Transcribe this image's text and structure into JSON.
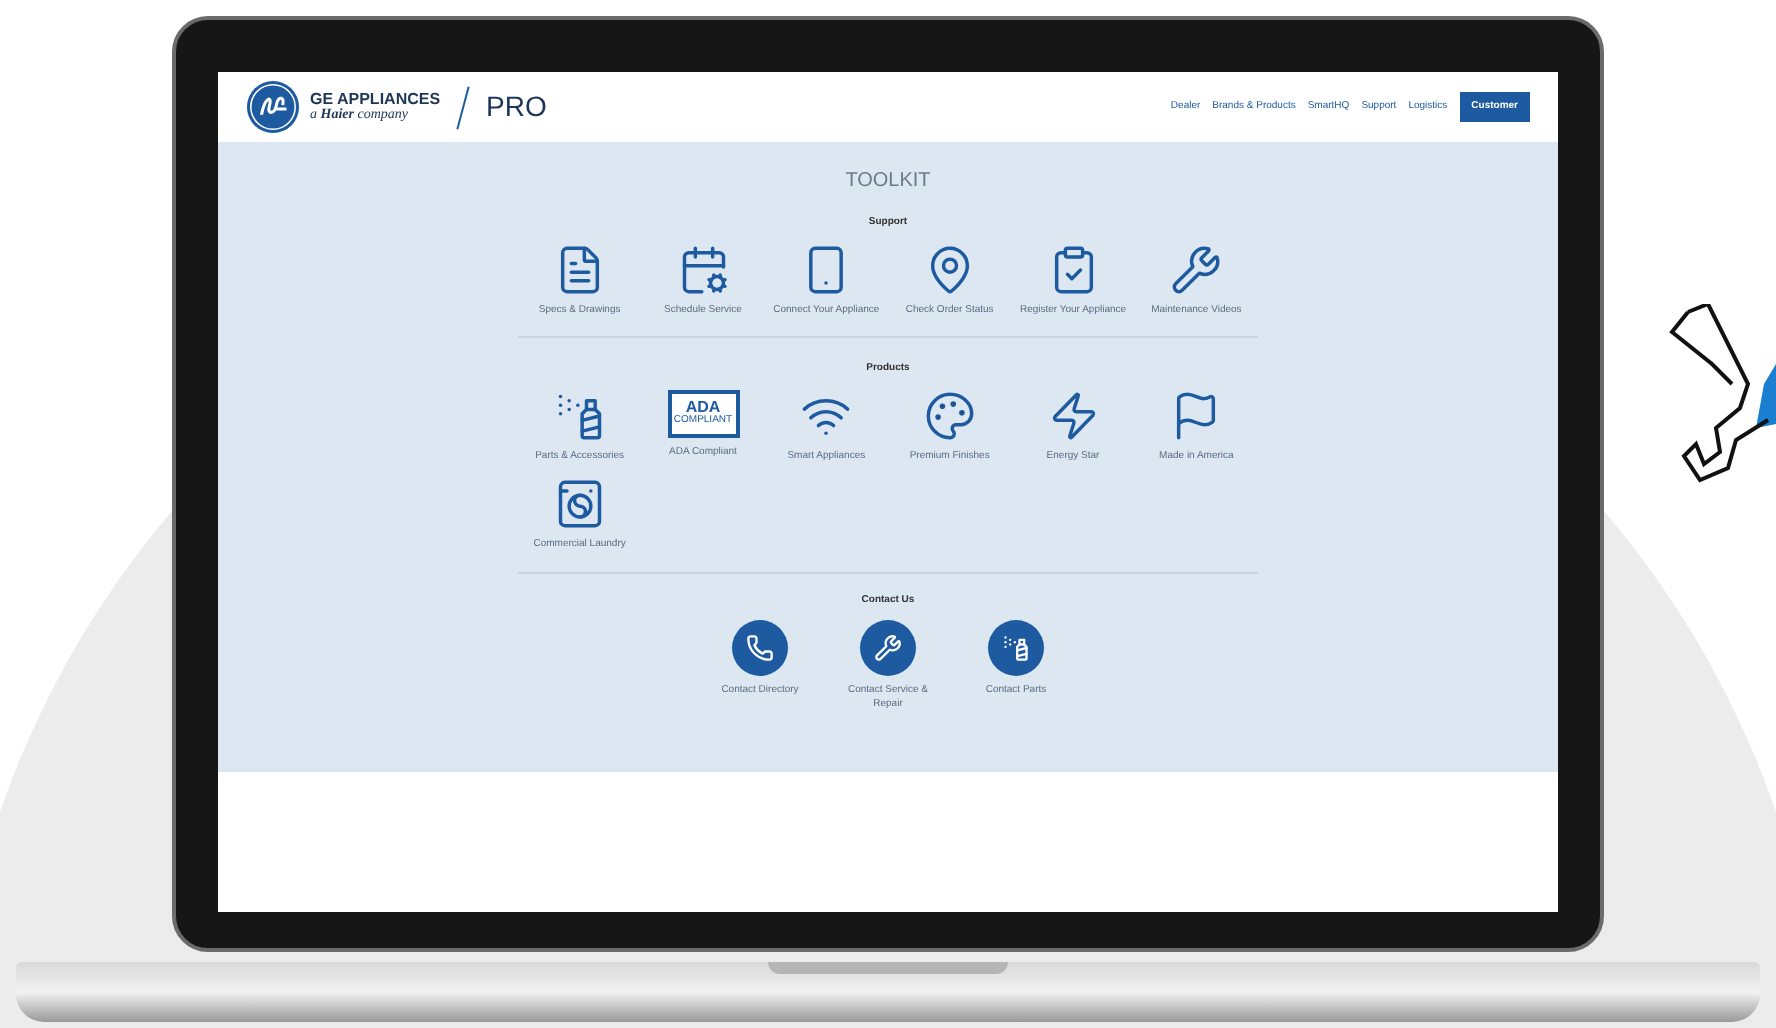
{
  "header": {
    "brand": "GE APPLIANCES",
    "tagline": "a **Haier** company",
    "product": "PRO",
    "nav": [
      "Dealer",
      "Brands & Products",
      "SmartHQ",
      "Support",
      "Logistics"
    ],
    "action": "Customer"
  },
  "toolkit": {
    "title": "TOOLKIT",
    "sections": [
      {
        "kind": "grid",
        "heading": "Support",
        "items": [
          "Specs & Drawings",
          "Schedule Service",
          "Connect Your Appliance",
          "Check Order Status",
          "Register Your Appliance",
          "Maintenance Videos"
        ]
      },
      {
        "kind": "grid",
        "heading": "Products",
        "items": [
          "Parts & Accessories",
          "ADA Compliant",
          "Smart Appliances",
          "Premium Finishes",
          "Energy Star",
          "Made in America",
          "Commercial Laundry"
        ],
        "badge": {
          "title": "ADA",
          "subtitle": "COMPLIANT"
        }
      },
      {
        "kind": "round",
        "heading": "Contact Us",
        "items": [
          "Contact Directory",
          "Contact Service & Repair",
          "Contact Parts"
        ]
      }
    ]
  }
}
